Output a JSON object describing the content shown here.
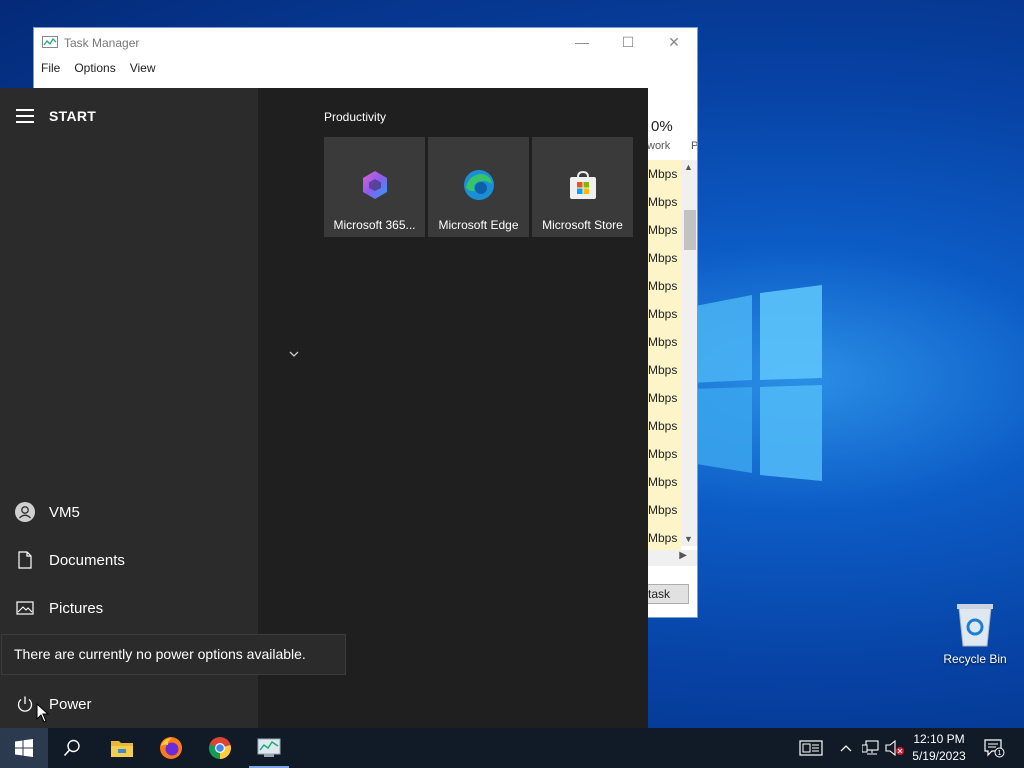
{
  "desktop": {
    "recycle_bin_label": "Recycle Bin"
  },
  "task_manager": {
    "title": "Task Manager",
    "menu": [
      "File",
      "Options",
      "View"
    ],
    "network_percent": "0%",
    "column_header_partial": "work",
    "column_header_partial_2": "P",
    "cell_values": [
      "Mbps",
      "Mbps",
      "Mbps",
      "Mbps",
      "Mbps",
      "Mbps",
      "Mbps",
      "Mbps",
      "Mbps",
      "Mbps",
      "Mbps",
      "Mbps",
      "Mbps",
      "Mbps"
    ],
    "end_task_partial": "task"
  },
  "start_menu": {
    "title": "START",
    "group_label": "Productivity",
    "tiles": [
      {
        "label": "Microsoft 365...",
        "icon": "microsoft-365-icon"
      },
      {
        "label": "Microsoft Edge",
        "icon": "edge-icon"
      },
      {
        "label": "Microsoft Store",
        "icon": "store-icon"
      }
    ],
    "sidebar": {
      "user": "VM5",
      "documents": "Documents",
      "pictures": "Pictures",
      "power": "Power"
    },
    "tooltip": "There are currently no power options available."
  },
  "taskbar": {
    "apps": [
      "start-icon",
      "search-icon",
      "file-explorer-icon",
      "firefox-icon",
      "chrome-icon",
      "task-manager-icon"
    ],
    "clock_time": "12:10 PM",
    "clock_date": "5/19/2023",
    "notification_count": "1"
  },
  "colors": {
    "accent": "#0078d7",
    "start_bg": "#1f1f1f",
    "start_sidebar_bg": "#2b2b2b",
    "tile_bg": "#3a3a3a",
    "taskbar_bg": "#111a27"
  }
}
